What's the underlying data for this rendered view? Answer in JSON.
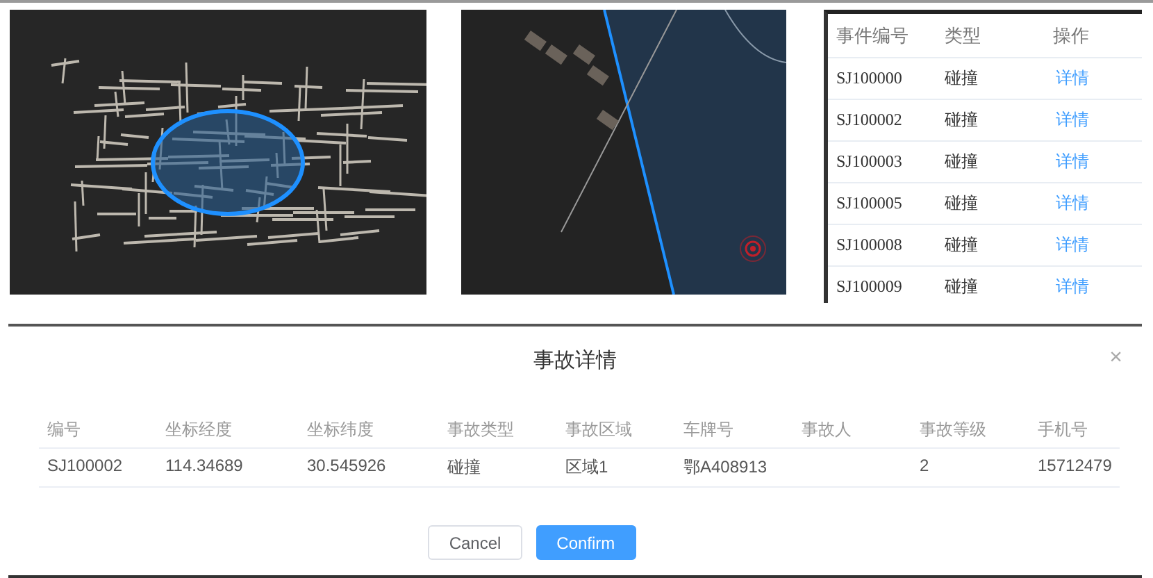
{
  "events_table": {
    "columns": [
      "事件编号",
      "类型",
      "操作"
    ],
    "rows": [
      {
        "id": "SJ100000",
        "type": "碰撞",
        "action": "详情"
      },
      {
        "id": "SJ100002",
        "type": "碰撞",
        "action": "详情"
      },
      {
        "id": "SJ100003",
        "type": "碰撞",
        "action": "详情"
      },
      {
        "id": "SJ100005",
        "type": "碰撞",
        "action": "详情"
      },
      {
        "id": "SJ100008",
        "type": "碰撞",
        "action": "详情"
      },
      {
        "id": "SJ100009",
        "type": "碰撞",
        "action": "详情"
      }
    ]
  },
  "dialog": {
    "title": "事故详情",
    "close": "×",
    "columns": [
      "编号",
      "坐标经度",
      "坐标纬度",
      "事故类型",
      "事故区域",
      "车牌号",
      "事故人",
      "事故等级",
      "手机号"
    ],
    "rows": [
      [
        "SJ100002",
        "114.34689",
        "30.545926",
        "碰撞",
        "区域1",
        "鄂A408913",
        "",
        "2",
        "15712479"
      ]
    ],
    "buttons": [
      {
        "label": "Cancel",
        "kind": "default"
      },
      {
        "label": "Confirm",
        "kind": "primary"
      }
    ]
  }
}
